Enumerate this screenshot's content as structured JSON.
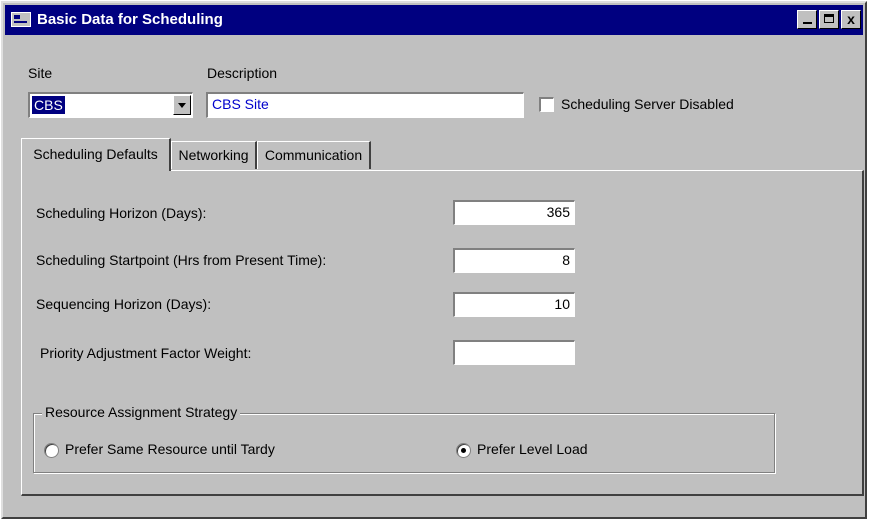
{
  "window": {
    "title": "Basic Data for Scheduling",
    "controls": {
      "minimize": "_",
      "maximize": "□",
      "close": "x"
    }
  },
  "header": {
    "site_label": "Site",
    "site_value": "CBS",
    "description_label": "Description",
    "description_value": "CBS Site",
    "server_disabled_label": "Scheduling Server Disabled",
    "server_disabled_checked": false
  },
  "tabs": [
    {
      "label": "Scheduling Defaults",
      "active": true
    },
    {
      "label": "Networking",
      "active": false
    },
    {
      "label": "Communication",
      "active": false
    }
  ],
  "defaults": {
    "horizon_label": "Scheduling Horizon (Days):",
    "horizon_value": "365",
    "startpoint_label": "Scheduling Startpoint (Hrs from Present Time):",
    "startpoint_value": "8",
    "sequencing_label": "Sequencing Horizon (Days):",
    "sequencing_value": "10",
    "priority_label": "Priority Adjustment Factor Weight:",
    "priority_value": ""
  },
  "strategy": {
    "title": "Resource Assignment Strategy",
    "option_same": "Prefer Same Resource until Tardy",
    "option_level": "Prefer Level Load",
    "selected": "Prefer Level Load"
  },
  "colors": {
    "titlebar": "#000080",
    "face": "#c0c0c0",
    "description_text": "#0000cc"
  }
}
